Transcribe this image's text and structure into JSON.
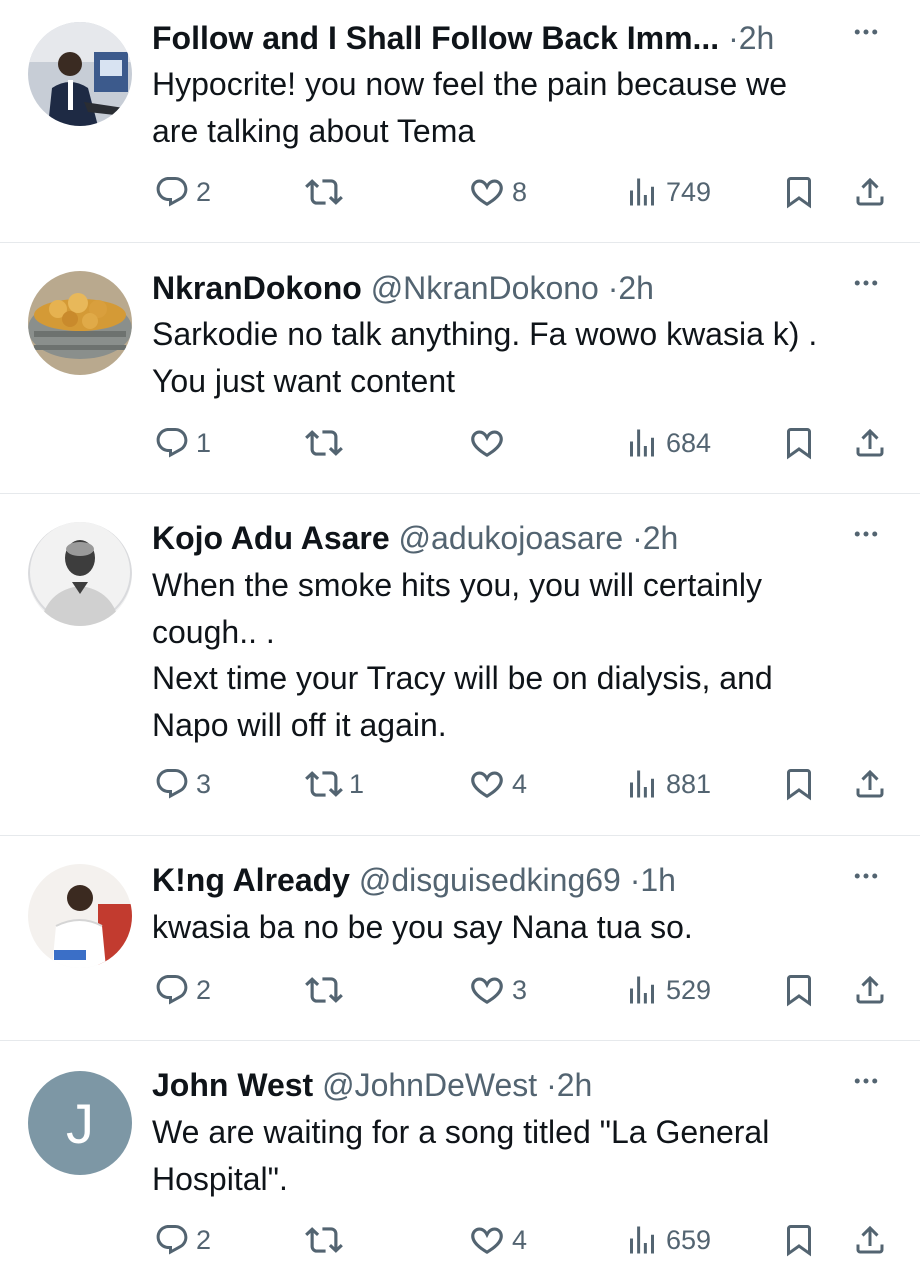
{
  "tweets": [
    {
      "name": "Follow and I Shall Follow Back Imm...",
      "handle": "",
      "time": "2h",
      "text": "Hypocrite! you now feel the pain because we\nare talking about Tema",
      "replies": "2",
      "retweets": "",
      "likes": "8",
      "views": "749"
    },
    {
      "name": "NkranDokono",
      "handle": "@NkranDokono",
      "time": "2h",
      "text": "Sarkodie no talk anything. Fa wowo kwasia k) .\nYou just want content",
      "replies": "1",
      "retweets": "",
      "likes": "",
      "views": "684"
    },
    {
      "name": "Kojo Adu Asare",
      "handle": "@adukojoasare",
      "time": "2h",
      "text": "When the smoke hits you, you will certainly\ncough.. .\nNext time your Tracy will be on dialysis, and\nNapo will off it again.",
      "replies": "3",
      "retweets": "1",
      "likes": "4",
      "views": "881"
    },
    {
      "name": "K!ng Already",
      "handle": "@disguisedking69",
      "time": "1h",
      "text": "kwasia ba no be you say Nana tua so.",
      "replies": "2",
      "retweets": "",
      "likes": "3",
      "views": "529"
    },
    {
      "name": "John West",
      "handle": "@JohnDeWest",
      "time": "2h",
      "avatar_letter": "J",
      "text": "We are waiting for a song titled \"La General\nHospital\".",
      "replies": "2",
      "retweets": "",
      "likes": "4",
      "views": "659"
    }
  ],
  "separator": "·",
  "colors": {
    "text": "#0f1419",
    "muted": "#536471",
    "divider": "#e6e9ec",
    "letter_avatar": "#7d97a5"
  },
  "icons": [
    "reply-icon",
    "retweet-icon",
    "like-icon",
    "views-icon",
    "bookmark-icon",
    "share-icon",
    "more-icon"
  ]
}
